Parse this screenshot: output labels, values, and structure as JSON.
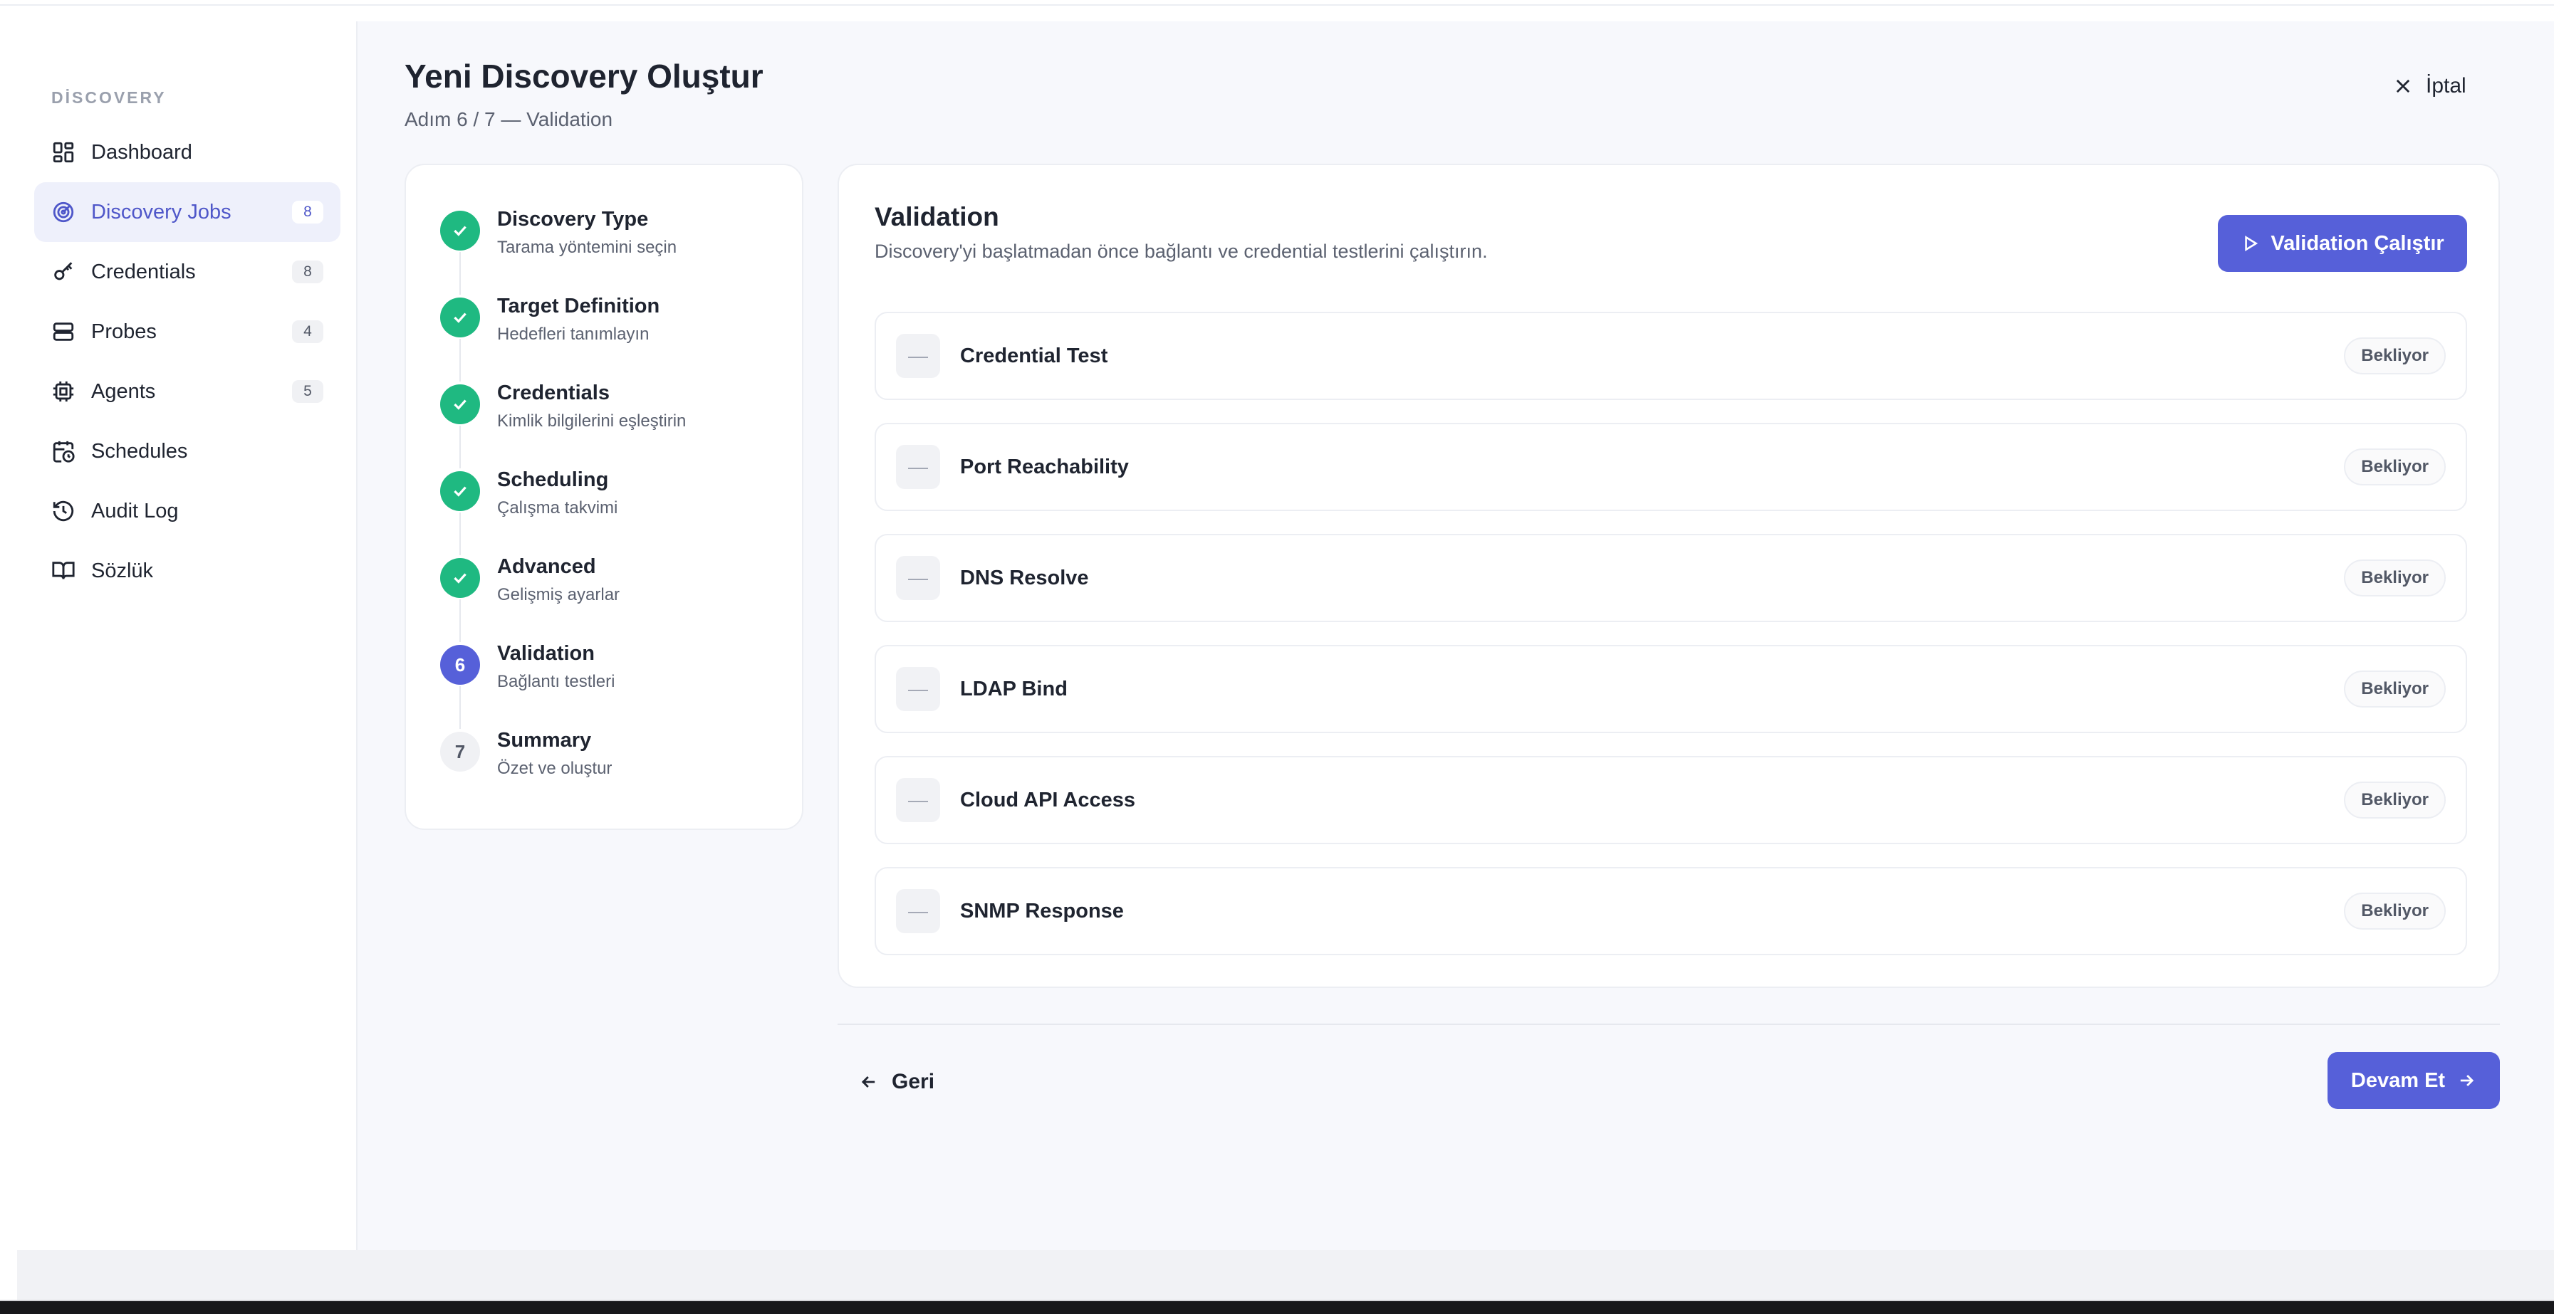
{
  "sidebar": {
    "heading": "DİSCOVERY",
    "items": [
      {
        "label": "Dashboard",
        "icon": "dashboard-icon",
        "badge": null,
        "active": false
      },
      {
        "label": "Discovery Jobs",
        "icon": "radar-icon",
        "badge": "8",
        "active": true
      },
      {
        "label": "Credentials",
        "icon": "key-icon",
        "badge": "8",
        "active": false
      },
      {
        "label": "Probes",
        "icon": "server-icon",
        "badge": "4",
        "active": false
      },
      {
        "label": "Agents",
        "icon": "cpu-icon",
        "badge": "5",
        "active": false
      },
      {
        "label": "Schedules",
        "icon": "calendar-clock-icon",
        "badge": null,
        "active": false
      },
      {
        "label": "Audit Log",
        "icon": "history-icon",
        "badge": null,
        "active": false
      },
      {
        "label": "Sözlük",
        "icon": "book-icon",
        "badge": null,
        "active": false
      }
    ]
  },
  "header": {
    "title": "Yeni Discovery Oluştur",
    "subtitle": "Adım 6 / 7 — Validation",
    "cancel_label": "İptal"
  },
  "steps": [
    {
      "number": "1",
      "title": "Discovery Type",
      "desc": "Tarama yöntemini seçin",
      "state": "done"
    },
    {
      "number": "2",
      "title": "Target Definition",
      "desc": "Hedefleri tanımlayın",
      "state": "done"
    },
    {
      "number": "3",
      "title": "Credentials",
      "desc": "Kimlik bilgilerini eşleştirin",
      "state": "done"
    },
    {
      "number": "4",
      "title": "Scheduling",
      "desc": "Çalışma takvimi",
      "state": "done"
    },
    {
      "number": "5",
      "title": "Advanced",
      "desc": "Gelişmiş ayarlar",
      "state": "done"
    },
    {
      "number": "6",
      "title": "Validation",
      "desc": "Bağlantı testleri",
      "state": "current"
    },
    {
      "number": "7",
      "title": "Summary",
      "desc": "Özet ve oluştur",
      "state": "todo"
    }
  ],
  "validation": {
    "title": "Validation",
    "description": "Discovery'yi başlatmadan önce bağlantı ve credential testlerini çalıştırın.",
    "run_label": "Validation Çalıştır",
    "checks": [
      {
        "name": "Credential Test",
        "status": "Bekliyor"
      },
      {
        "name": "Port Reachability",
        "status": "Bekliyor"
      },
      {
        "name": "DNS Resolve",
        "status": "Bekliyor"
      },
      {
        "name": "LDAP Bind",
        "status": "Bekliyor"
      },
      {
        "name": "Cloud API Access",
        "status": "Bekliyor"
      },
      {
        "name": "SNMP Response",
        "status": "Bekliyor"
      }
    ]
  },
  "footer": {
    "back_label": "Geri",
    "next_label": "Devam Et"
  },
  "colors": {
    "accent": "#5660d9",
    "success": "#1fb981",
    "active_bg": "#eef0fb"
  }
}
